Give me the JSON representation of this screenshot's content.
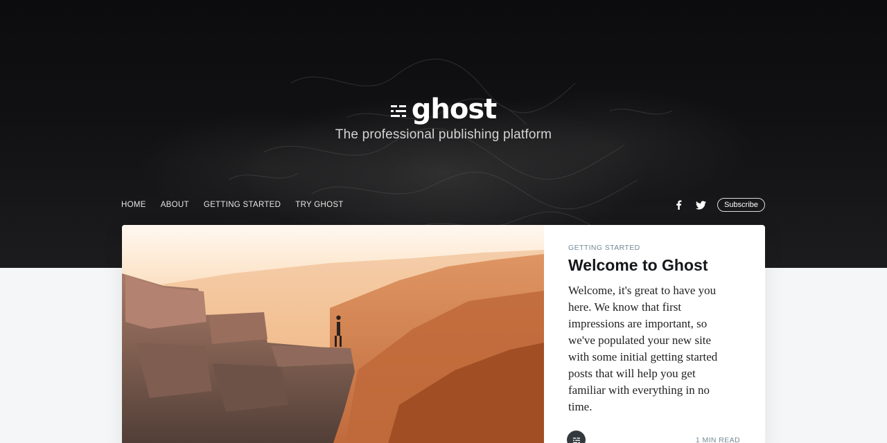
{
  "header": {
    "logo_text": "ghost",
    "logo_icon": "ghost-logo-icon",
    "tagline": "The professional publishing platform"
  },
  "nav": {
    "links": [
      {
        "label": "HOME"
      },
      {
        "label": "ABOUT"
      },
      {
        "label": "GETTING STARTED"
      },
      {
        "label": "TRY GHOST"
      }
    ],
    "social": [
      "facebook-icon",
      "twitter-icon"
    ],
    "subscribe_label": "Subscribe"
  },
  "featured_post": {
    "tag": "GETTING STARTED",
    "title": "Welcome to Ghost",
    "excerpt": "Welcome, it's great to have you here. We know that first impressions are important, so we've populated your new site with some initial getting started posts that will help you get familiar with everything in no time.",
    "reading_time": "1 MIN READ"
  },
  "colors": {
    "hero_background": "#111113",
    "page_background": "#f4f6f8",
    "meta_text": "#738a94",
    "title_text": "#15171a"
  }
}
